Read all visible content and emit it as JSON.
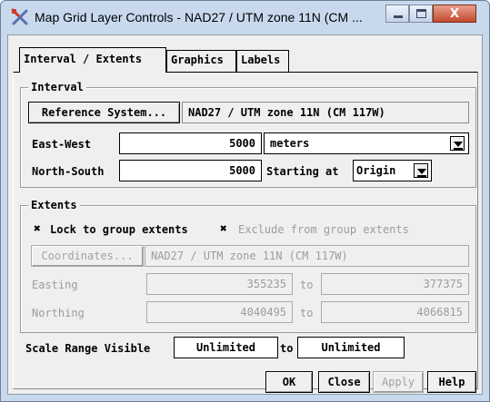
{
  "window": {
    "title": "Map Grid Layer Controls - NAD27 / UTM zone 11N (CM ...",
    "minimize_label": "–",
    "maximize_label": "▭",
    "close_label": "X"
  },
  "tabs": [
    {
      "label": "Interval / Extents",
      "active": true
    },
    {
      "label": "Graphics",
      "active": false
    },
    {
      "label": "Labels",
      "active": false
    }
  ],
  "interval": {
    "group_title": "Interval",
    "reference_system_button": "Reference System...",
    "reference_system_value": "NAD27 / UTM zone 11N (CM 117W)",
    "east_west_label": "East-West",
    "east_west_value": "5000",
    "units_value": "meters",
    "north_south_label": "North-South",
    "north_south_value": "5000",
    "starting_at_label": "Starting at",
    "starting_at_value": "Origin"
  },
  "extents": {
    "group_title": "Extents",
    "lock_checkbox_mark": "✖",
    "lock_label": "Lock to group extents",
    "lock_checked": true,
    "exclude_checkbox_mark": "✖",
    "exclude_label": "Exclude from group extents",
    "exclude_checked": true,
    "coordinates_button": "Coordinates...",
    "coordinates_value": "NAD27 / UTM zone 11N (CM 117W)",
    "easting_label": "Easting",
    "easting_min": "355235",
    "easting_to": "to",
    "easting_max": "377375",
    "northing_label": "Northing",
    "northing_min": "4040495",
    "northing_to": "to",
    "northing_max": "4066815"
  },
  "scale_range": {
    "label": "Scale Range Visible",
    "min_value": "Unlimited",
    "to": "to",
    "max_value": "Unlimited"
  },
  "buttons": {
    "ok": "OK",
    "close": "Close",
    "apply": "Apply",
    "help": "Help"
  },
  "colors": {
    "window_frame": "#c8d9ee",
    "dialog_bg": "#efefef",
    "close_button": "#c24a2e",
    "disabled_text": "#9c9c9c"
  }
}
